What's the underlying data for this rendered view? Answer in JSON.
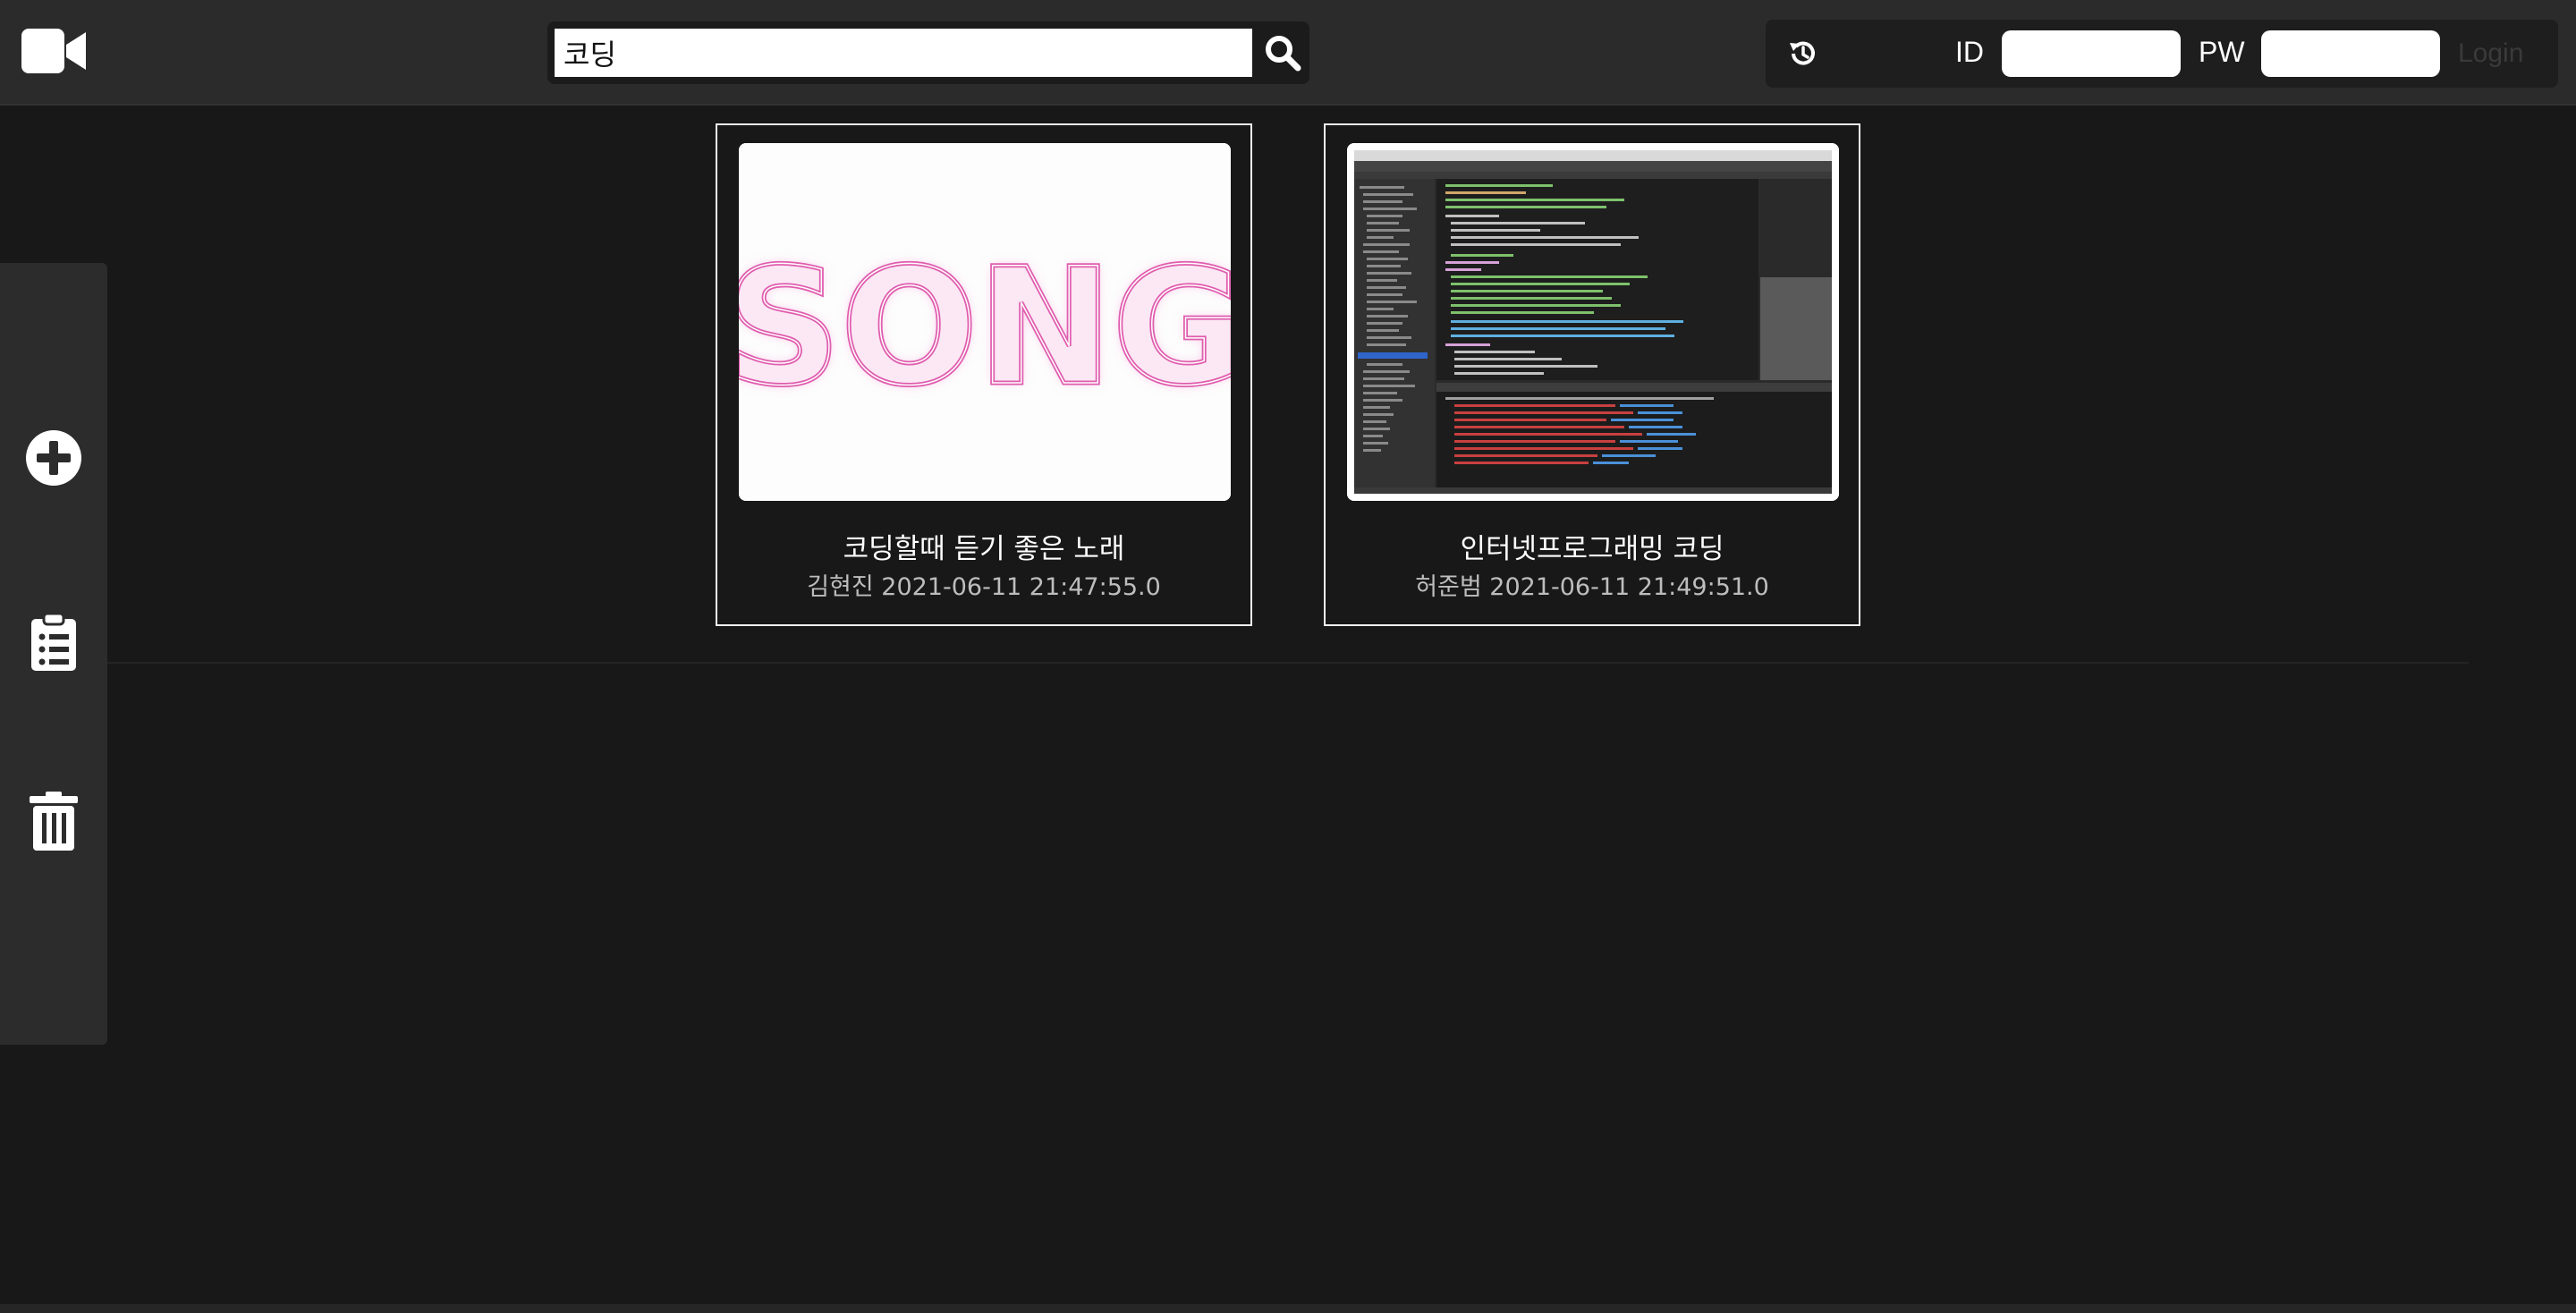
{
  "header": {
    "logo_icon": "video-camera-icon",
    "search": {
      "value": "코딩",
      "icon": "search-icon"
    },
    "history_icon": "history-icon",
    "id_label": "ID",
    "pw_label": "PW",
    "login_label": "Login"
  },
  "sidebar": {
    "items": [
      {
        "icon": "add-circle-icon"
      },
      {
        "icon": "clipboard-list-icon"
      },
      {
        "icon": "trash-icon"
      }
    ]
  },
  "videos": [
    {
      "thumbnail_text": "SONG",
      "title": "코딩할때 듣기 좋은 노래",
      "meta": "김현진 2021-06-11 21:47:55.0"
    },
    {
      "thumbnail_text": "",
      "title": "인터넷프로그래밍 코딩",
      "meta": "허준범 2021-06-11 21:49:51.0"
    }
  ]
}
